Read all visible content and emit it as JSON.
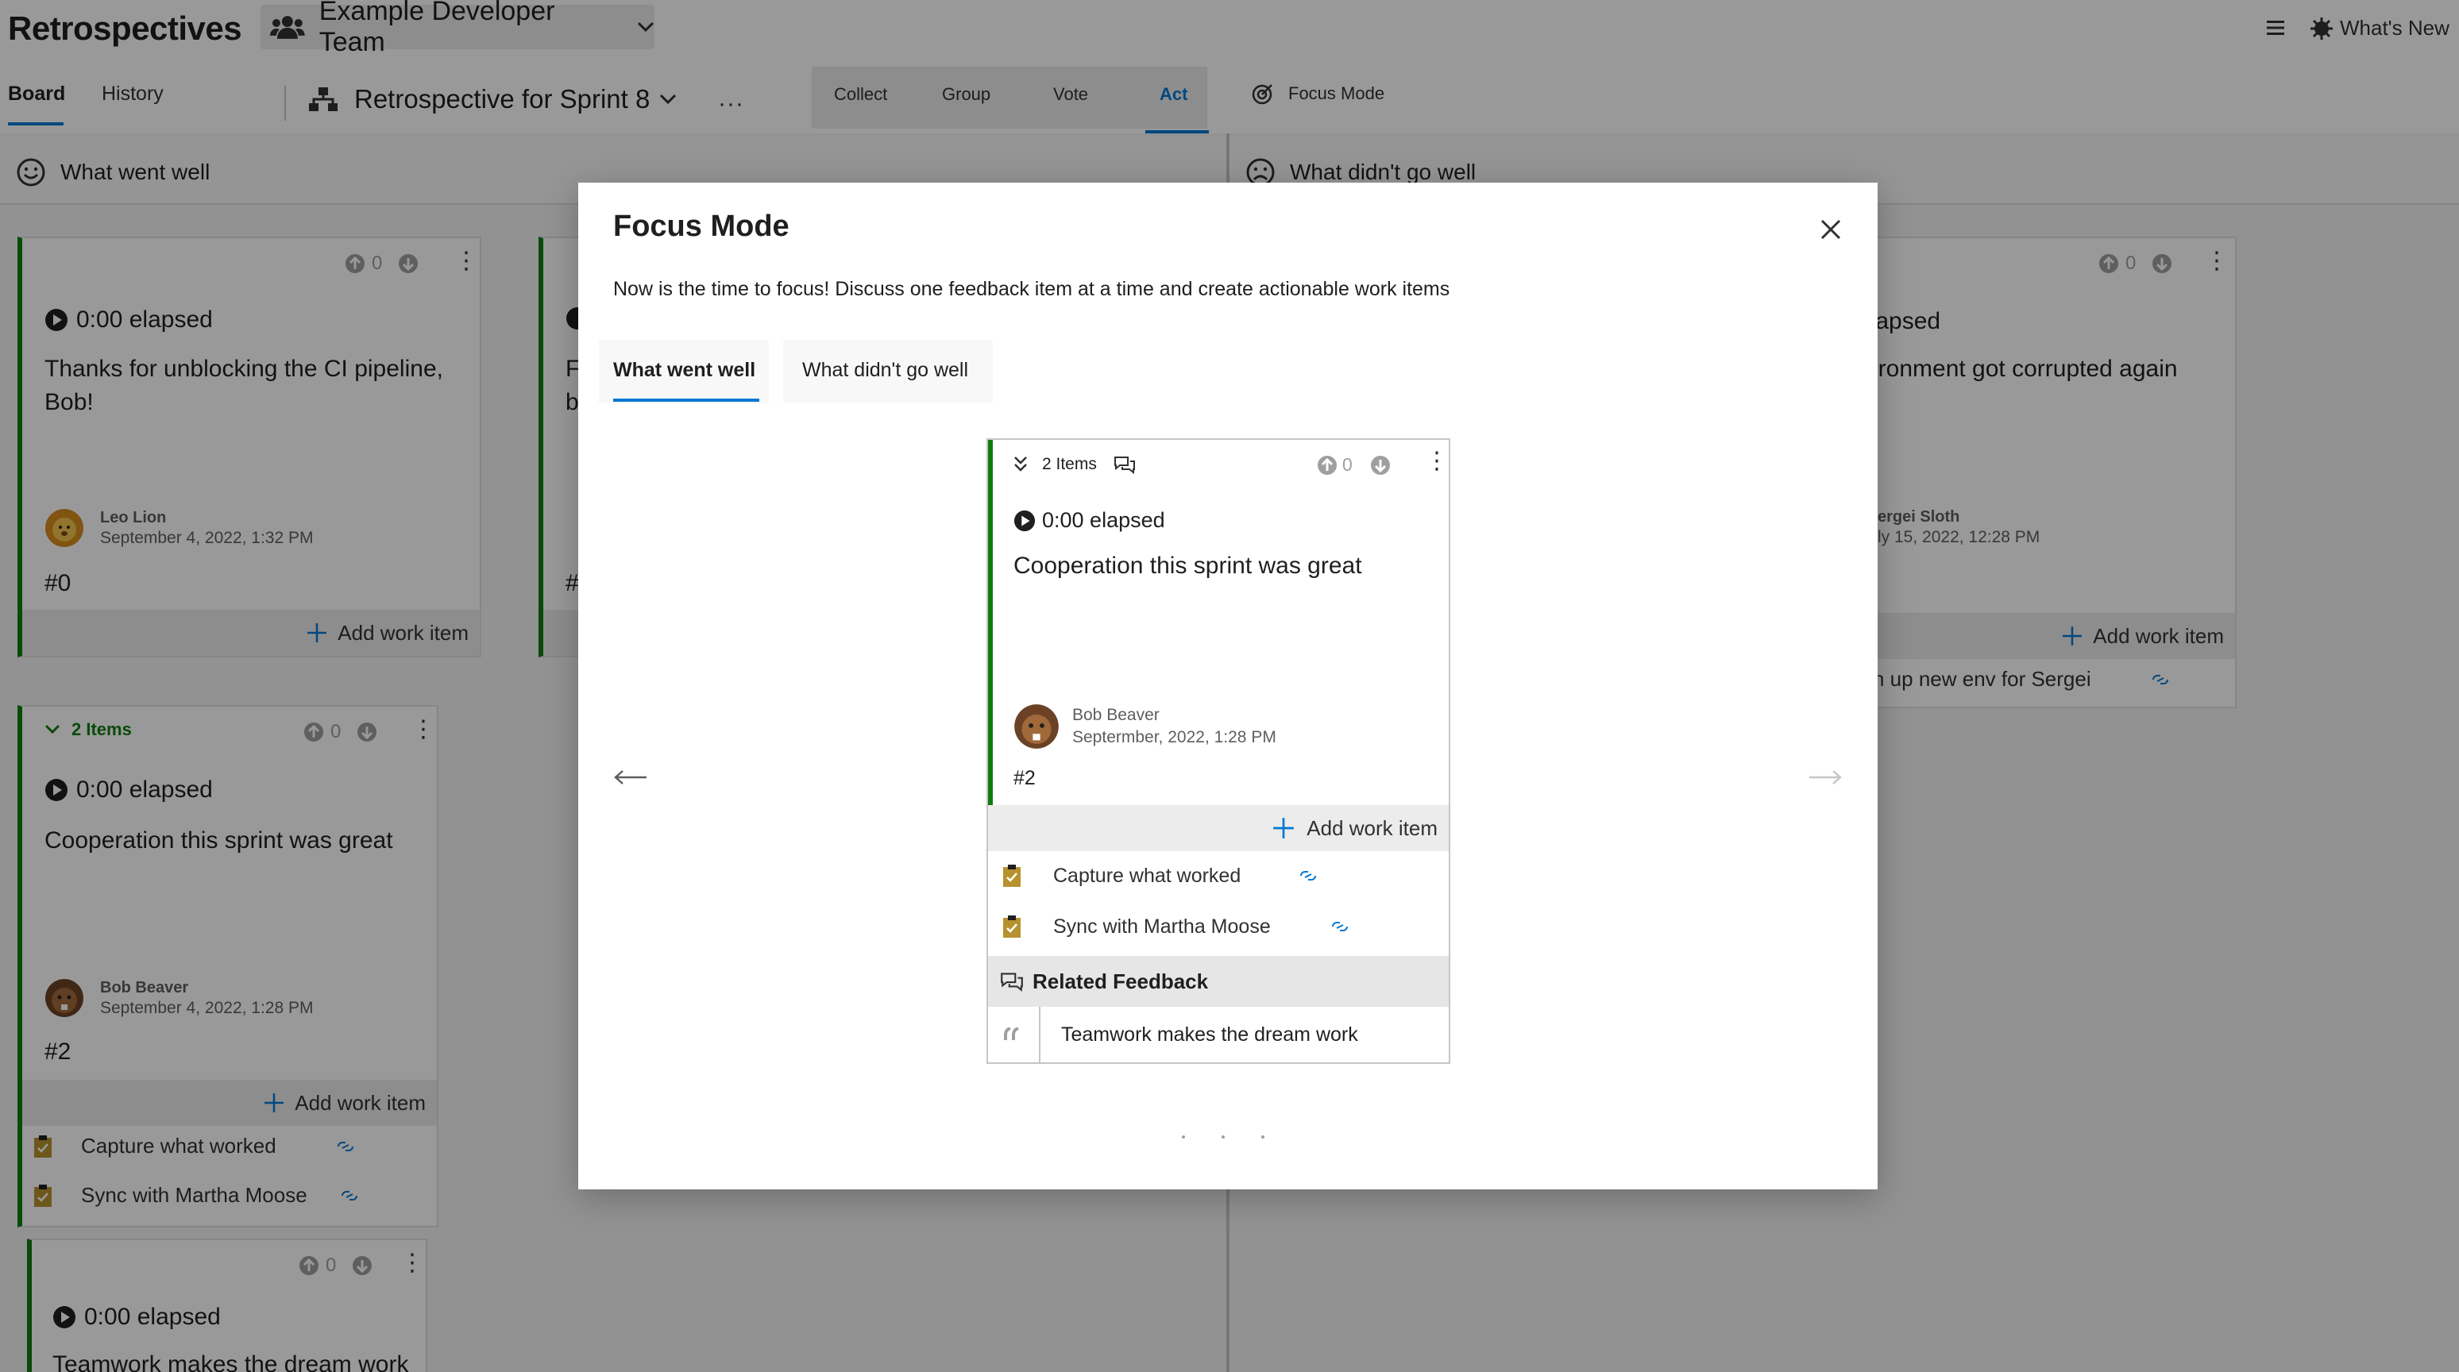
{
  "header": {
    "app_title": "Retrospectives",
    "team": "Example Developer Team",
    "whats_new": "What's New"
  },
  "nav": {
    "board": "Board",
    "history": "History",
    "retro": "Retrospective for Sprint 8",
    "more": "···",
    "phases": [
      "Collect",
      "Group",
      "Vote",
      "Act"
    ],
    "active_phase": "Act",
    "focus_mode": "Focus Mode"
  },
  "columns": {
    "left_title": "What went well",
    "right_title": "What didn't go well"
  },
  "board_cards": {
    "c0": {
      "votes": "0",
      "elapsed": "0:00 elapsed",
      "text": "Thanks for unblocking the CI pipeline, Bob!",
      "author": "Leo Lion",
      "date": "September 4, 2022, 1:32 PM",
      "id": "#0",
      "add": "Add work item"
    },
    "c_partial_left": {
      "text_fragment": "F b",
      "id": "#"
    },
    "c_group": {
      "items": "2 Items",
      "votes": "0",
      "elapsed": "0:00 elapsed",
      "text": "Cooperation this sprint was great",
      "author": "Bob Beaver",
      "date": "September 4, 2022, 1:28 PM",
      "id": "#2",
      "add": "Add work item",
      "work_items": [
        "Capture what worked",
        "Sync with Martha Moose"
      ]
    },
    "c_bottom": {
      "votes": "0",
      "elapsed": "0:00 elapsed",
      "text": "Teamwork makes the dream work"
    },
    "c_right": {
      "votes": "0",
      "elapsed": "elapsed",
      "text": "ironment got corrupted again",
      "author": "ergei Sloth",
      "date": "ly 15, 2022, 12:28 PM",
      "add": "Add work item",
      "work_item": "n up new env for Sergei"
    }
  },
  "modal": {
    "title": "Focus Mode",
    "description": "Now is the time to focus! Discuss one feedback item at a time and create actionable work items",
    "tabs": [
      "What went well",
      "What didn't go well"
    ],
    "card": {
      "items": "2 Items",
      "votes": "0",
      "elapsed": "0:00 elapsed",
      "text": "Cooperation this sprint was great",
      "author": "Bob Beaver",
      "date": "Septermber, 2022, 1:28 PM",
      "id": "#2",
      "add": "Add work item",
      "work_items": [
        "Capture what worked",
        "Sync with Martha Moose"
      ],
      "related_title": "Related Feedback",
      "related_items": [
        "Teamwork makes the dream work"
      ]
    }
  },
  "colors": {
    "accent": "#0078d4",
    "well_green": "#107c10",
    "overlay": "rgba(0,0,0,0.4)"
  }
}
